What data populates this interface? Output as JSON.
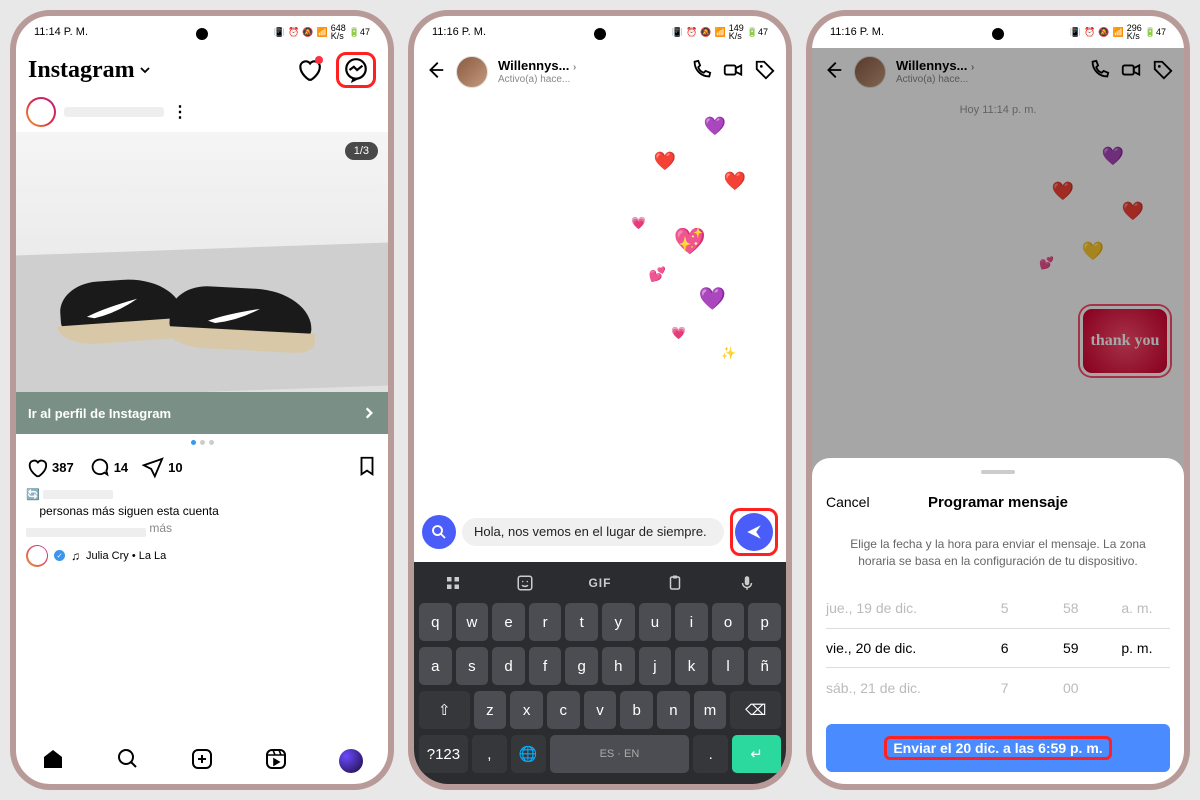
{
  "status": {
    "t1": "11:14 P. M.",
    "t2": "11:16 P. M.",
    "t3": "11:16 P. M.",
    "net1": "648",
    "net2": "149",
    "net3": "296",
    "netUnit": "K/s",
    "batt": "47"
  },
  "screen1": {
    "logo": "Instagram",
    "counter": "1/3",
    "cta": "Ir al perfil de Instagram",
    "likes": "387",
    "comments": "14",
    "shares": "10",
    "followLine": "personas más siguen esta cuenta",
    "more": "más",
    "music": "Julia Cry • La La"
  },
  "screen2": {
    "name": "Willennys...",
    "status": "Activo(a) hace...",
    "message": "Hola, nos vemos en el lugar de siempre.",
    "gif": "GIF",
    "keys_r1": [
      "q",
      "w",
      "e",
      "r",
      "t",
      "y",
      "u",
      "i",
      "o",
      "p"
    ],
    "keys_r2": [
      "a",
      "s",
      "d",
      "f",
      "g",
      "h",
      "j",
      "k",
      "l",
      "ñ"
    ],
    "keys_r3": [
      "z",
      "x",
      "c",
      "v",
      "b",
      "n",
      "m"
    ],
    "lang": "ES · EN",
    "numKey": "?123"
  },
  "screen3": {
    "name": "Willennys...",
    "status": "Activo(a) hace...",
    "timestamp": "Hoy 11:14 p. m.",
    "sticker": "thank you",
    "cancel": "Cancel",
    "title": "Programar mensaje",
    "desc": "Elige la fecha y la hora para enviar el mensaje. La zona horaria se basa en la configuración de tu dispositivo.",
    "picker": {
      "r1": {
        "date": "jue., 19 de dic.",
        "h": "5",
        "m": "58",
        "ap": "a. m."
      },
      "r2": {
        "date": "vie., 20 de dic.",
        "h": "6",
        "m": "59",
        "ap": "p. m."
      },
      "r3": {
        "date": "sáb., 21 de dic.",
        "h": "7",
        "m": "00",
        "ap": ""
      }
    },
    "button": "Enviar el 20 dic. a las 6:59 p. m."
  }
}
